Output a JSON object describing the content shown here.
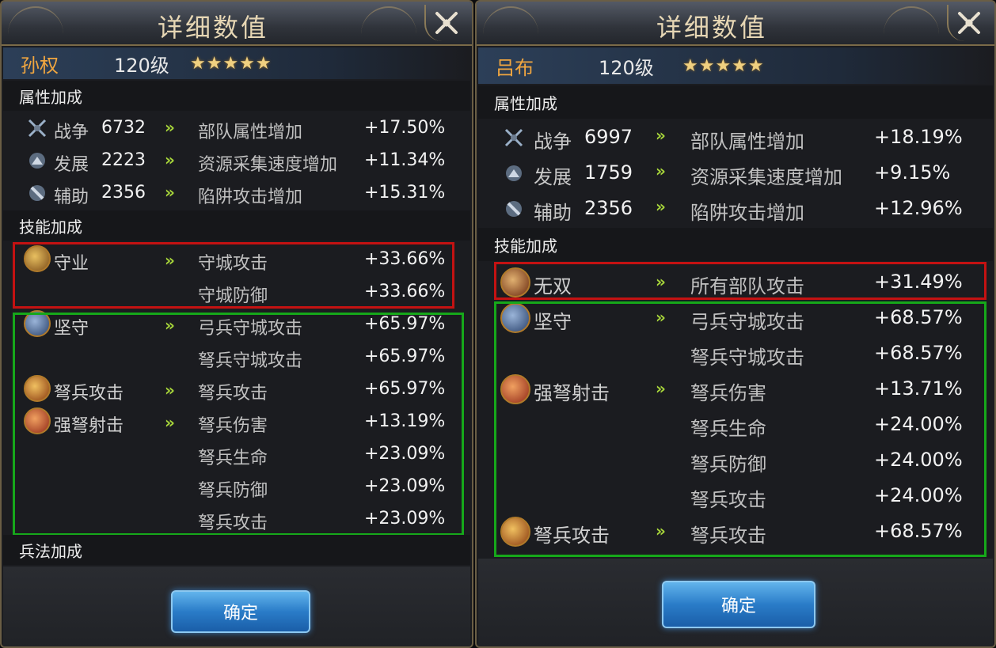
{
  "title": "详细数值",
  "left": {
    "hero": {
      "name": "孙权",
      "level": "120级",
      "stars": "★★★★★"
    },
    "attr_section": "属性加成",
    "attributes": [
      {
        "icon": "crossed-swords-icon",
        "label": "战争",
        "value": "6732",
        "arrow": "»",
        "desc": "部队属性增加",
        "pct": "+17.50%"
      },
      {
        "icon": "development-icon",
        "label": "发展",
        "value": "2223",
        "arrow": "»",
        "desc": "资源采集速度增加",
        "pct": "+11.34%"
      },
      {
        "icon": "support-icon",
        "label": "辅助",
        "value": "2356",
        "arrow": "»",
        "desc": "陷阱攻击增加",
        "pct": "+15.31%"
      }
    ],
    "skill_section": "技能加成",
    "skills": [
      {
        "name": "守业",
        "arrow": "»",
        "desc": "守城攻击",
        "pct": "+33.66%"
      },
      {
        "name": "",
        "arrow": "",
        "desc": "守城防御",
        "pct": "+33.66%"
      },
      {
        "name": "坚守",
        "arrow": "»",
        "desc": "弓兵守城攻击",
        "pct": "+65.97%"
      },
      {
        "name": "",
        "arrow": "",
        "desc": "弩兵守城攻击",
        "pct": "+65.97%"
      },
      {
        "name": "弩兵攻击",
        "arrow": "»",
        "desc": "弩兵攻击",
        "pct": "+65.97%"
      },
      {
        "name": "强弩射击",
        "arrow": "»",
        "desc": "弩兵伤害",
        "pct": "+13.19%"
      },
      {
        "name": "",
        "arrow": "",
        "desc": "弩兵生命",
        "pct": "+23.09%"
      },
      {
        "name": "",
        "arrow": "",
        "desc": "弩兵防御",
        "pct": "+23.09%"
      },
      {
        "name": "",
        "arrow": "",
        "desc": "弩兵攻击",
        "pct": "+23.09%"
      }
    ],
    "tactics_section": "兵法加成",
    "confirm": "确定"
  },
  "right": {
    "hero": {
      "name": "吕布",
      "level": "120级",
      "stars": "★★★★★"
    },
    "attr_section": "属性加成",
    "attributes": [
      {
        "icon": "crossed-swords-icon",
        "label": "战争",
        "value": "6997",
        "arrow": "»",
        "desc": "部队属性增加",
        "pct": "+18.19%"
      },
      {
        "icon": "development-icon",
        "label": "发展",
        "value": "1759",
        "arrow": "»",
        "desc": "资源采集速度增加",
        "pct": "+9.15%"
      },
      {
        "icon": "support-icon",
        "label": "辅助",
        "value": "2356",
        "arrow": "»",
        "desc": "陷阱攻击增加",
        "pct": "+12.96%"
      }
    ],
    "skill_section": "技能加成",
    "skills": [
      {
        "name": "无双",
        "arrow": "»",
        "desc": "所有部队攻击",
        "pct": "+31.49%"
      },
      {
        "name": "坚守",
        "arrow": "»",
        "desc": "弓兵守城攻击",
        "pct": "+68.57%"
      },
      {
        "name": "",
        "arrow": "",
        "desc": "弩兵守城攻击",
        "pct": "+68.57%"
      },
      {
        "name": "强弩射击",
        "arrow": "»",
        "desc": "弩兵伤害",
        "pct": "+13.71%"
      },
      {
        "name": "",
        "arrow": "",
        "desc": "弩兵生命",
        "pct": "+24.00%"
      },
      {
        "name": "",
        "arrow": "",
        "desc": "弩兵防御",
        "pct": "+24.00%"
      },
      {
        "name": "",
        "arrow": "",
        "desc": "弩兵攻击",
        "pct": "+24.00%"
      },
      {
        "name": "弩兵攻击",
        "arrow": "»",
        "desc": "弩兵攻击",
        "pct": "+68.57%"
      }
    ],
    "confirm": "确定"
  },
  "colors": {
    "hero_name": "#f0a640",
    "arrow": "#a6d43a",
    "highlight_red": "#c41212",
    "highlight_green": "#16a81a",
    "button": "#2a7cc8"
  }
}
